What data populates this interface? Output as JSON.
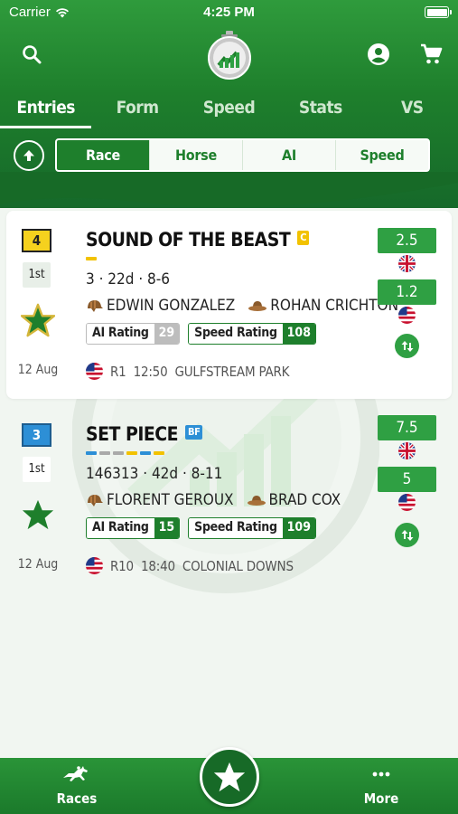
{
  "status_bar": {
    "carrier": "Carrier",
    "time": "4:25 PM"
  },
  "header": {
    "tabs": [
      {
        "label": "Entries",
        "active": true
      },
      {
        "label": "Form",
        "active": false
      },
      {
        "label": "Speed",
        "active": false
      },
      {
        "label": "Stats",
        "active": false
      },
      {
        "label": "VS",
        "active": false
      }
    ],
    "segments": [
      {
        "label": "Race",
        "active": true
      },
      {
        "label": "Horse",
        "active": false
      },
      {
        "label": "AI",
        "active": false
      },
      {
        "label": "Speed",
        "active": false
      }
    ]
  },
  "colors": {
    "brand_green": "#1e7f2c",
    "odds_green": "#2fa043",
    "star_gold": "#c9a227",
    "post_yellow": "#f5d11e",
    "post_blue": "#2d8fd6"
  },
  "entries": [
    {
      "post": "4",
      "place": "1st",
      "horse": "SOUND OF THE BEAST",
      "tag": "C",
      "stats": "3 · 22d · 8-6",
      "jockey": "EDWIN GONZALEZ",
      "trainer": "ROHAN CRICHTON",
      "ai_label": "AI Rating",
      "ai_value": "29",
      "speed_label": "Speed Rating",
      "speed_value": "108",
      "date": "12 Aug",
      "race_no": "R1",
      "race_time": "12:50",
      "track": "GULFSTREAM PARK",
      "odds": [
        {
          "value": "2.5",
          "flag": "uk-flag"
        },
        {
          "value": "1.2",
          "flag": "us-flag"
        }
      ],
      "fav_icon": "star-filled-gold-icon"
    },
    {
      "post": "3",
      "place": "1st",
      "horse": "SET PIECE",
      "tag": "BF",
      "stats": "146313 · 42d · 8-11",
      "jockey": "FLORENT GEROUX",
      "trainer": "BRAD COX",
      "ai_label": "AI Rating",
      "ai_value": "15",
      "speed_label": "Speed Rating",
      "speed_value": "109",
      "date": "12 Aug",
      "race_no": "R10",
      "race_time": "18:40",
      "track": "COLONIAL DOWNS",
      "odds": [
        {
          "value": "7.5",
          "flag": "uk-flag"
        },
        {
          "value": "5",
          "flag": "us-flag"
        }
      ],
      "fav_icon": "star-filled-green-icon"
    }
  ],
  "bottom_nav": {
    "races": "Races",
    "more": "More"
  }
}
